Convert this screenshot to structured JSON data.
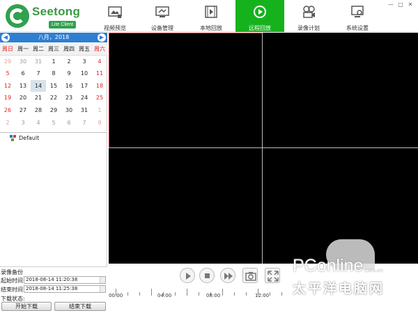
{
  "logo": {
    "name": "Seetong",
    "sub": "Lite Client"
  },
  "nav": [
    {
      "label": "视频预览",
      "icon": "video-preview-icon"
    },
    {
      "label": "设备管理",
      "icon": "device-management-icon"
    },
    {
      "label": "本地回放",
      "icon": "local-playback-icon"
    },
    {
      "label": "远程回放",
      "icon": "remote-playback-icon",
      "active": true
    },
    {
      "label": "录像计划",
      "icon": "record-schedule-icon"
    },
    {
      "label": "系统设置",
      "icon": "system-settings-icon"
    }
  ],
  "window_controls": [
    "—",
    "□",
    "✕"
  ],
  "calendar": {
    "month_label": "八月，2018",
    "weekdays": [
      "周日",
      "周一",
      "周二",
      "周三",
      "周四",
      "周五",
      "周六"
    ],
    "weeks": [
      [
        "29",
        "30",
        "31",
        "1",
        "2",
        "3",
        "4"
      ],
      [
        "5",
        "6",
        "7",
        "8",
        "9",
        "10",
        "11"
      ],
      [
        "12",
        "13",
        "14",
        "15",
        "16",
        "17",
        "18"
      ],
      [
        "19",
        "20",
        "21",
        "22",
        "23",
        "24",
        "25"
      ],
      [
        "26",
        "27",
        "28",
        "29",
        "30",
        "31",
        "1"
      ],
      [
        "2",
        "3",
        "4",
        "5",
        "6",
        "7",
        "8"
      ]
    ],
    "selected": "14"
  },
  "device_tree": {
    "root": "Default"
  },
  "backup": {
    "title": "录像备份",
    "start_label": "起始时间",
    "start_value": "2018-08-14 11:20:38",
    "end_label": "结束时间",
    "end_value": "2018-08-14 11:25:38",
    "status_label": "下载状态:",
    "start_download": "开始下载",
    "stop_download": "结束下载"
  },
  "playback": {
    "controls": [
      "play-icon",
      "stop-icon",
      "fast-forward-icon",
      "snapshot-icon",
      "fullscreen-icon"
    ],
    "time_labels": [
      "00:00",
      "04:00",
      "08:00",
      "12:00"
    ]
  },
  "watermark": {
    "brand": "PConline",
    "url": ".com.cn",
    "chinese": "太平洋电脑网"
  }
}
